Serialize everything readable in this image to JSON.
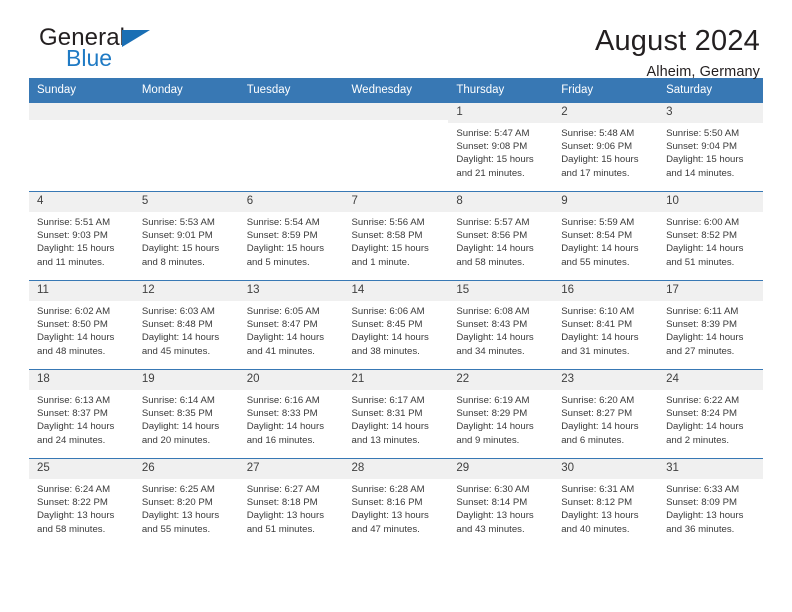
{
  "logo": {
    "primary_text": "General",
    "secondary_text": "Blue",
    "triangle_color": "#1a6fb4",
    "secondary_color": "#1f7ac4"
  },
  "header": {
    "title": "August 2024",
    "subtitle": "Alheim, Germany"
  },
  "theme": {
    "header_row_bg": "#3878b4",
    "daynum_bg": "#f0f0f0",
    "row_border": "#3878b4"
  },
  "calendar": {
    "weekday_headers": [
      "Sunday",
      "Monday",
      "Tuesday",
      "Wednesday",
      "Thursday",
      "Friday",
      "Saturday"
    ],
    "labels": {
      "sunrise": "Sunrise:",
      "sunset": "Sunset:",
      "daylight": "Daylight:"
    },
    "weeks": [
      [
        {
          "day": "",
          "empty": true
        },
        {
          "day": "",
          "empty": true
        },
        {
          "day": "",
          "empty": true
        },
        {
          "day": "",
          "empty": true
        },
        {
          "day": "1",
          "sunrise": "Sunrise: 5:47 AM",
          "sunset": "Sunset: 9:08 PM",
          "daylight_line1": "Daylight: 15 hours",
          "daylight_line2": "and 21 minutes."
        },
        {
          "day": "2",
          "sunrise": "Sunrise: 5:48 AM",
          "sunset": "Sunset: 9:06 PM",
          "daylight_line1": "Daylight: 15 hours",
          "daylight_line2": "and 17 minutes."
        },
        {
          "day": "3",
          "sunrise": "Sunrise: 5:50 AM",
          "sunset": "Sunset: 9:04 PM",
          "daylight_line1": "Daylight: 15 hours",
          "daylight_line2": "and 14 minutes."
        }
      ],
      [
        {
          "day": "4",
          "sunrise": "Sunrise: 5:51 AM",
          "sunset": "Sunset: 9:03 PM",
          "daylight_line1": "Daylight: 15 hours",
          "daylight_line2": "and 11 minutes."
        },
        {
          "day": "5",
          "sunrise": "Sunrise: 5:53 AM",
          "sunset": "Sunset: 9:01 PM",
          "daylight_line1": "Daylight: 15 hours",
          "daylight_line2": "and 8 minutes."
        },
        {
          "day": "6",
          "sunrise": "Sunrise: 5:54 AM",
          "sunset": "Sunset: 8:59 PM",
          "daylight_line1": "Daylight: 15 hours",
          "daylight_line2": "and 5 minutes."
        },
        {
          "day": "7",
          "sunrise": "Sunrise: 5:56 AM",
          "sunset": "Sunset: 8:58 PM",
          "daylight_line1": "Daylight: 15 hours",
          "daylight_line2": "and 1 minute."
        },
        {
          "day": "8",
          "sunrise": "Sunrise: 5:57 AM",
          "sunset": "Sunset: 8:56 PM",
          "daylight_line1": "Daylight: 14 hours",
          "daylight_line2": "and 58 minutes."
        },
        {
          "day": "9",
          "sunrise": "Sunrise: 5:59 AM",
          "sunset": "Sunset: 8:54 PM",
          "daylight_line1": "Daylight: 14 hours",
          "daylight_line2": "and 55 minutes."
        },
        {
          "day": "10",
          "sunrise": "Sunrise: 6:00 AM",
          "sunset": "Sunset: 8:52 PM",
          "daylight_line1": "Daylight: 14 hours",
          "daylight_line2": "and 51 minutes."
        }
      ],
      [
        {
          "day": "11",
          "sunrise": "Sunrise: 6:02 AM",
          "sunset": "Sunset: 8:50 PM",
          "daylight_line1": "Daylight: 14 hours",
          "daylight_line2": "and 48 minutes."
        },
        {
          "day": "12",
          "sunrise": "Sunrise: 6:03 AM",
          "sunset": "Sunset: 8:48 PM",
          "daylight_line1": "Daylight: 14 hours",
          "daylight_line2": "and 45 minutes."
        },
        {
          "day": "13",
          "sunrise": "Sunrise: 6:05 AM",
          "sunset": "Sunset: 8:47 PM",
          "daylight_line1": "Daylight: 14 hours",
          "daylight_line2": "and 41 minutes."
        },
        {
          "day": "14",
          "sunrise": "Sunrise: 6:06 AM",
          "sunset": "Sunset: 8:45 PM",
          "daylight_line1": "Daylight: 14 hours",
          "daylight_line2": "and 38 minutes."
        },
        {
          "day": "15",
          "sunrise": "Sunrise: 6:08 AM",
          "sunset": "Sunset: 8:43 PM",
          "daylight_line1": "Daylight: 14 hours",
          "daylight_line2": "and 34 minutes."
        },
        {
          "day": "16",
          "sunrise": "Sunrise: 6:10 AM",
          "sunset": "Sunset: 8:41 PM",
          "daylight_line1": "Daylight: 14 hours",
          "daylight_line2": "and 31 minutes."
        },
        {
          "day": "17",
          "sunrise": "Sunrise: 6:11 AM",
          "sunset": "Sunset: 8:39 PM",
          "daylight_line1": "Daylight: 14 hours",
          "daylight_line2": "and 27 minutes."
        }
      ],
      [
        {
          "day": "18",
          "sunrise": "Sunrise: 6:13 AM",
          "sunset": "Sunset: 8:37 PM",
          "daylight_line1": "Daylight: 14 hours",
          "daylight_line2": "and 24 minutes."
        },
        {
          "day": "19",
          "sunrise": "Sunrise: 6:14 AM",
          "sunset": "Sunset: 8:35 PM",
          "daylight_line1": "Daylight: 14 hours",
          "daylight_line2": "and 20 minutes."
        },
        {
          "day": "20",
          "sunrise": "Sunrise: 6:16 AM",
          "sunset": "Sunset: 8:33 PM",
          "daylight_line1": "Daylight: 14 hours",
          "daylight_line2": "and 16 minutes."
        },
        {
          "day": "21",
          "sunrise": "Sunrise: 6:17 AM",
          "sunset": "Sunset: 8:31 PM",
          "daylight_line1": "Daylight: 14 hours",
          "daylight_line2": "and 13 minutes."
        },
        {
          "day": "22",
          "sunrise": "Sunrise: 6:19 AM",
          "sunset": "Sunset: 8:29 PM",
          "daylight_line1": "Daylight: 14 hours",
          "daylight_line2": "and 9 minutes."
        },
        {
          "day": "23",
          "sunrise": "Sunrise: 6:20 AM",
          "sunset": "Sunset: 8:27 PM",
          "daylight_line1": "Daylight: 14 hours",
          "daylight_line2": "and 6 minutes."
        },
        {
          "day": "24",
          "sunrise": "Sunrise: 6:22 AM",
          "sunset": "Sunset: 8:24 PM",
          "daylight_line1": "Daylight: 14 hours",
          "daylight_line2": "and 2 minutes."
        }
      ],
      [
        {
          "day": "25",
          "sunrise": "Sunrise: 6:24 AM",
          "sunset": "Sunset: 8:22 PM",
          "daylight_line1": "Daylight: 13 hours",
          "daylight_line2": "and 58 minutes."
        },
        {
          "day": "26",
          "sunrise": "Sunrise: 6:25 AM",
          "sunset": "Sunset: 8:20 PM",
          "daylight_line1": "Daylight: 13 hours",
          "daylight_line2": "and 55 minutes."
        },
        {
          "day": "27",
          "sunrise": "Sunrise: 6:27 AM",
          "sunset": "Sunset: 8:18 PM",
          "daylight_line1": "Daylight: 13 hours",
          "daylight_line2": "and 51 minutes."
        },
        {
          "day": "28",
          "sunrise": "Sunrise: 6:28 AM",
          "sunset": "Sunset: 8:16 PM",
          "daylight_line1": "Daylight: 13 hours",
          "daylight_line2": "and 47 minutes."
        },
        {
          "day": "29",
          "sunrise": "Sunrise: 6:30 AM",
          "sunset": "Sunset: 8:14 PM",
          "daylight_line1": "Daylight: 13 hours",
          "daylight_line2": "and 43 minutes."
        },
        {
          "day": "30",
          "sunrise": "Sunrise: 6:31 AM",
          "sunset": "Sunset: 8:12 PM",
          "daylight_line1": "Daylight: 13 hours",
          "daylight_line2": "and 40 minutes."
        },
        {
          "day": "31",
          "sunrise": "Sunrise: 6:33 AM",
          "sunset": "Sunset: 8:09 PM",
          "daylight_line1": "Daylight: 13 hours",
          "daylight_line2": "and 36 minutes."
        }
      ]
    ]
  }
}
